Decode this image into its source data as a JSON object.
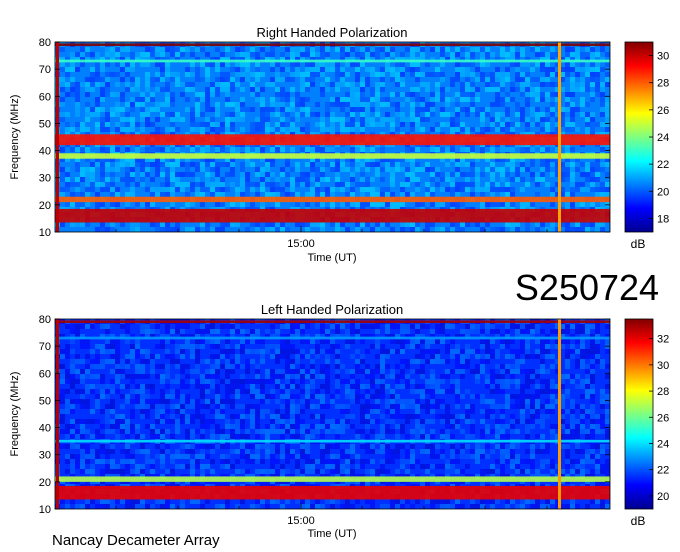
{
  "chart_data": [
    {
      "type": "heatmap",
      "title": "Right Handed Polarization",
      "xlabel": "Time (UT)",
      "ylabel": "Frequency (MHz)",
      "x_ticks": [
        "15:00"
      ],
      "y_ticks": [
        10,
        20,
        30,
        40,
        50,
        60,
        70,
        80
      ],
      "ylim": [
        10,
        80
      ],
      "colorbar": {
        "label": "dB",
        "ticks": [
          18,
          20,
          22,
          24,
          26,
          28,
          30
        ],
        "range": [
          17,
          31
        ]
      },
      "features": [
        {
          "kind": "band",
          "freq": 44,
          "width": 4,
          "level_db": 29
        },
        {
          "kind": "band",
          "freq": 38,
          "width": 2,
          "level_db": 25
        },
        {
          "kind": "band",
          "freq": 22,
          "width": 2,
          "level_db": 28
        },
        {
          "kind": "band",
          "freq": 16,
          "width": 5,
          "level_db": 30
        },
        {
          "kind": "band",
          "freq": 79,
          "width": 1,
          "level_db": 31
        },
        {
          "kind": "band",
          "freq": 73,
          "width": 1,
          "level_db": 23
        }
      ]
    },
    {
      "type": "heatmap",
      "title": "Left Handed Polarization",
      "xlabel": "Time (UT)",
      "ylabel": "Frequency (MHz)",
      "x_ticks": [
        "15:00"
      ],
      "y_ticks": [
        10,
        20,
        30,
        40,
        50,
        60,
        70,
        80
      ],
      "ylim": [
        10,
        80
      ],
      "colorbar": {
        "label": "dB",
        "ticks": [
          20,
          22,
          24,
          26,
          28,
          30,
          32
        ],
        "range": [
          19,
          33.5
        ]
      },
      "features": [
        {
          "kind": "band",
          "freq": 16,
          "width": 5,
          "level_db": 32
        },
        {
          "kind": "band",
          "freq": 21,
          "width": 2,
          "level_db": 27
        },
        {
          "kind": "band",
          "freq": 79,
          "width": 1,
          "level_db": 33
        },
        {
          "kind": "band",
          "freq": 35,
          "width": 1,
          "level_db": 24
        },
        {
          "kind": "band",
          "freq": 73,
          "width": 1,
          "level_db": 23
        }
      ]
    }
  ],
  "date_label": "S250724",
  "footer_label": "Nancay Decameter Array"
}
